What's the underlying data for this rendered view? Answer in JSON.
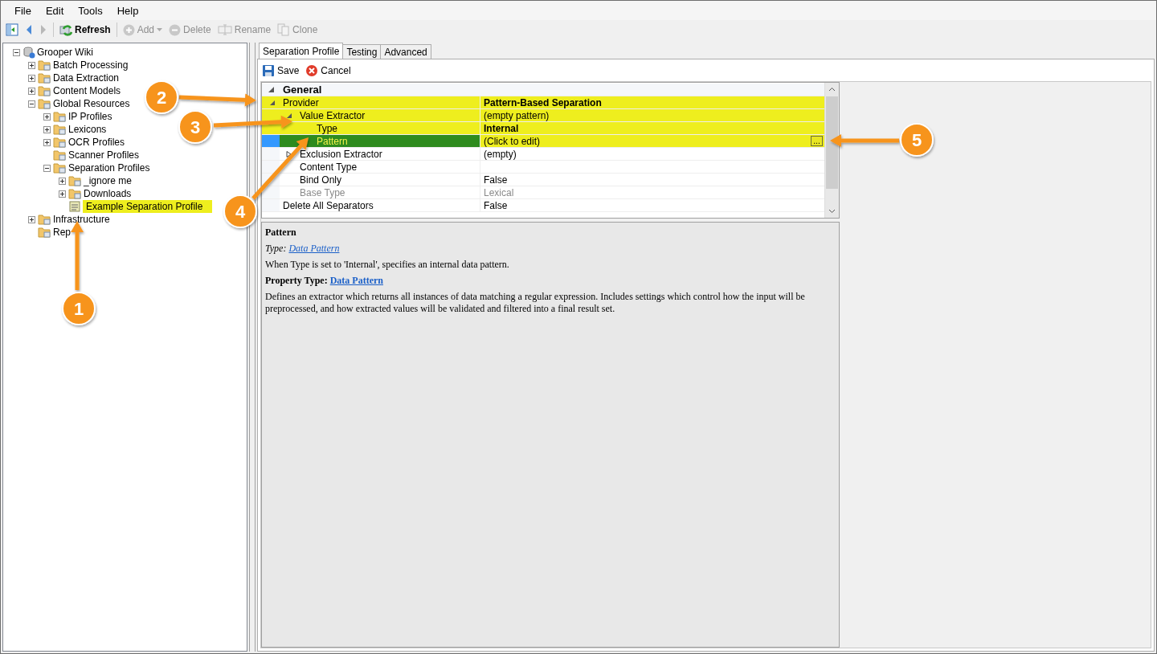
{
  "menu": [
    "File",
    "Edit",
    "Tools",
    "Help"
  ],
  "toolbar": [
    {
      "kind": "nav"
    },
    {
      "kind": "back",
      "disabled": false
    },
    {
      "kind": "forward",
      "disabled": true
    },
    {
      "kind": "refresh",
      "label": "Refresh",
      "disabled": false
    },
    {
      "kind": "add",
      "label": "Add",
      "disabled": true
    },
    {
      "kind": "delete",
      "label": "Delete",
      "disabled": true
    },
    {
      "kind": "rename",
      "label": "Rename",
      "disabled": true
    },
    {
      "kind": "clone",
      "label": "Clone",
      "disabled": true
    }
  ],
  "tree": {
    "label": "Grooper Wiki",
    "expanded": true,
    "highlighted": false,
    "children": [
      {
        "label": "Batch Processing",
        "expanded": false,
        "highlighted": false
      },
      {
        "label": "Data Extraction",
        "expanded": false,
        "highlighted": false
      },
      {
        "label": "Content Models",
        "expanded": false,
        "highlighted": false
      },
      {
        "label": "Global Resources",
        "expanded": true,
        "highlighted": false,
        "children": [
          {
            "label": "IP Profiles",
            "expanded": false,
            "highlighted": false
          },
          {
            "label": "Lexicons",
            "expanded": false,
            "highlighted": false
          },
          {
            "label": "OCR Profiles",
            "expanded": false,
            "highlighted": false
          },
          {
            "label": "Scanner Profiles",
            "highlighted": false
          },
          {
            "label": "Separation Profiles",
            "expanded": true,
            "highlighted": false,
            "children": [
              {
                "label": "_ignore me",
                "expanded": false,
                "highlighted": false
              },
              {
                "label": "Downloads",
                "expanded": false,
                "highlighted": false
              },
              {
                "label": "Example Separation Profile",
                "kind": "profile",
                "highlighted": true
              }
            ]
          }
        ]
      },
      {
        "label": "Infrastructure",
        "expanded": false,
        "highlighted": false
      },
      {
        "label": "Rep",
        "highlighted": false
      }
    ]
  },
  "tabs": [
    {
      "label": "Separation Profile",
      "selected": true
    },
    {
      "label": "Testing",
      "selected": false
    },
    {
      "label": "Advanced",
      "selected": false
    }
  ],
  "actions": [
    {
      "kind": "save",
      "label": "Save"
    },
    {
      "kind": "cancel",
      "label": "Cancel"
    }
  ],
  "properties": {
    "category": "General",
    "expanded": true,
    "children": [
      {
        "name": "Provider",
        "value": "Pattern-Based Separation",
        "expanded": true,
        "value_bold": true,
        "disabled": false,
        "highlighted": true,
        "selected": false,
        "children": [
          {
            "name": "Value Extractor",
            "value": "(empty pattern)",
            "expanded": true,
            "value_bold": false,
            "disabled": false,
            "highlighted": true,
            "selected": false,
            "children": [
              {
                "name": "Type",
                "value": "Internal",
                "value_bold": true,
                "disabled": false,
                "highlighted": true,
                "selected": false
              },
              {
                "name": "Pattern",
                "value": "(Click to edit)",
                "value_bold": false,
                "disabled": false,
                "highlighted": true,
                "selected": true,
                "button": "..."
              }
            ]
          },
          {
            "name": "Exclusion Extractor",
            "value": "(empty)",
            "expanded": false,
            "value_bold": false,
            "disabled": false,
            "highlighted": false,
            "selected": false
          },
          {
            "name": "Content Type",
            "disabled": false,
            "highlighted": false,
            "selected": false
          },
          {
            "name": "Bind Only",
            "value": "False",
            "value_bold": false,
            "disabled": false,
            "highlighted": false,
            "selected": false
          },
          {
            "name": "Base Type",
            "value": "Lexical",
            "value_bold": false,
            "disabled": true,
            "highlighted": false,
            "selected": false
          }
        ]
      },
      {
        "name": "Delete All Separators",
        "value": "False",
        "value_bold": false,
        "disabled": false,
        "highlighted": false,
        "selected": false
      }
    ]
  },
  "description": {
    "title": "Pattern",
    "type_label": "Type:",
    "type_link": "Data Pattern",
    "summary": "When Type is set to 'Internal', specifies an internal data pattern.",
    "property_type_label": "Property Type:",
    "property_type_link": "Data Pattern",
    "details": "Defines an extractor which returns all instances of data matching a regular expression. Includes settings which control how the input will be preprocessed, and how extracted values will be validated and filtered into a final result set."
  },
  "callouts": [
    "1",
    "2",
    "3",
    "4",
    "5"
  ]
}
